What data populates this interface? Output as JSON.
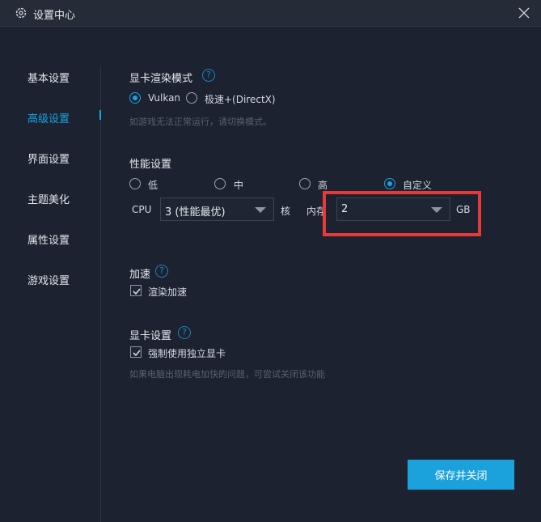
{
  "window": {
    "title": "设置中心",
    "icons": {
      "settings": "gear-icon",
      "close": "close-icon"
    }
  },
  "sidebar": {
    "items": [
      {
        "label": "基本设置",
        "active": false
      },
      {
        "label": "高级设置",
        "active": true
      },
      {
        "label": "界面设置",
        "active": false
      },
      {
        "label": "主题美化",
        "active": false
      },
      {
        "label": "属性设置",
        "active": false
      },
      {
        "label": "游戏设置",
        "active": false
      }
    ]
  },
  "render": {
    "title": "显卡渲染模式",
    "options": [
      {
        "label": "Vulkan",
        "checked": true
      },
      {
        "label": "极速+(DirectX)",
        "checked": false
      }
    ],
    "hint": "如游戏无法正常运行，请切换模式。"
  },
  "performance": {
    "title": "性能设置",
    "options": [
      {
        "label": "低",
        "checked": false
      },
      {
        "label": "中",
        "checked": false
      },
      {
        "label": "高",
        "checked": false
      },
      {
        "label": "自定义",
        "checked": true
      }
    ],
    "cpu_label": "CPU",
    "cpu_value": "3 (性能最优)",
    "cpu_unit": "核",
    "memory_label": "内存",
    "memory_value": "2",
    "memory_unit": "GB"
  },
  "acceleration": {
    "title": "加速",
    "checkbox_label": "渲染加速",
    "checked": true
  },
  "gpu": {
    "title": "显卡设置",
    "checkbox_label": "强制使用独立显卡",
    "checked": true,
    "hint": "如果电脑出现耗电加快的问题，可尝试关闭该功能"
  },
  "footer": {
    "save_label": "保存并关闭"
  },
  "colors": {
    "accent": "#1aa3e3",
    "highlight": "#e43a3a",
    "background": "#1c2230"
  }
}
